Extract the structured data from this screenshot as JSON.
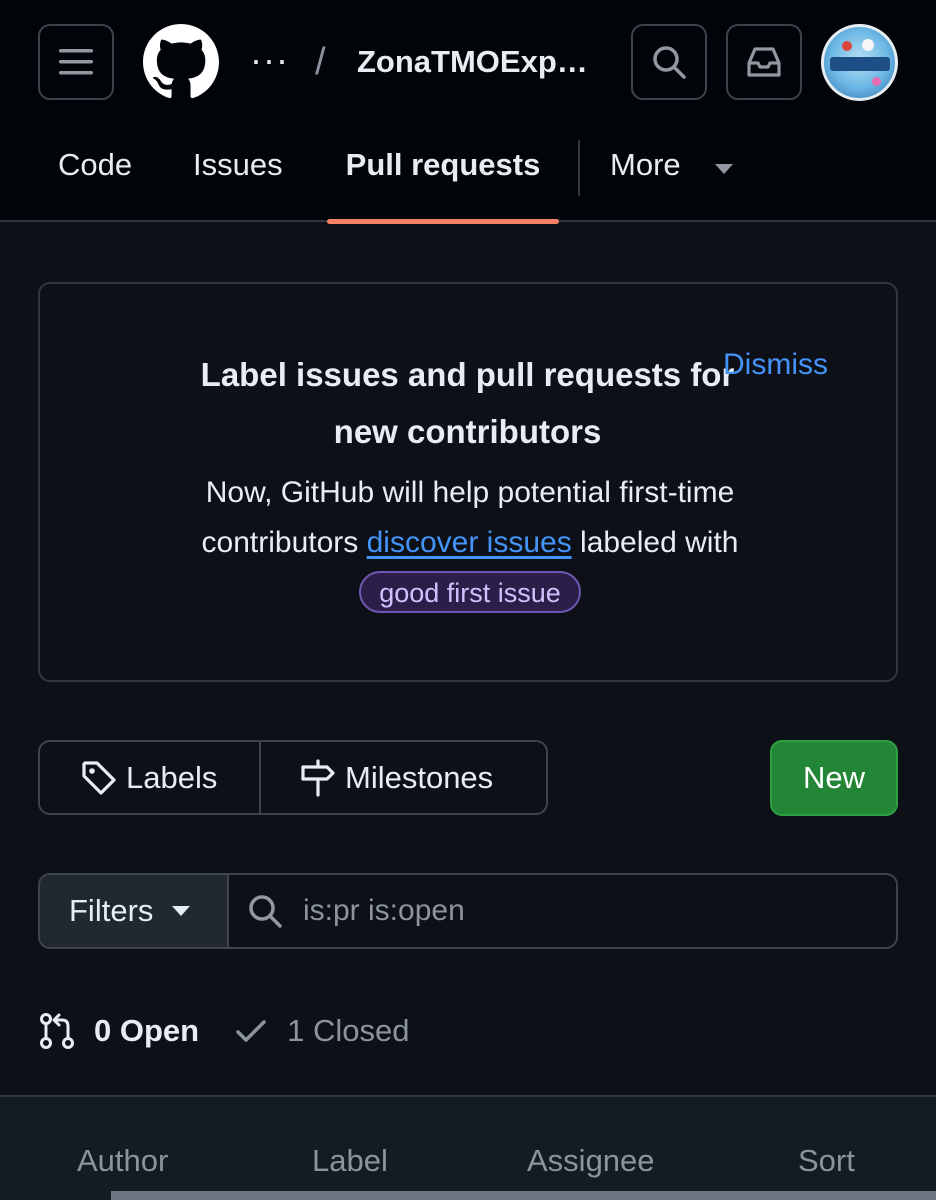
{
  "header": {
    "breadcrumb_ellipsis": "···",
    "separator": "/",
    "repo_name": "ZonaTMOExp…"
  },
  "tabs": [
    {
      "label": "Code"
    },
    {
      "label": "Issues"
    },
    {
      "label": "Pull requests",
      "selected": true
    },
    {
      "label": "More"
    }
  ],
  "banner": {
    "title": "Label issues and pull requests for new contributors",
    "dismiss_label": "Dismiss",
    "body_before_link": "Now, GitHub will help potential first-time contributors ",
    "link_text": "discover issues",
    "body_after_link": " labeled with ",
    "label_chip": "good first issue"
  },
  "actions": {
    "labels": "Labels",
    "milestones": "Milestones",
    "new": "New"
  },
  "filters": {
    "button_label": "Filters",
    "search_placeholder": "is:pr is:open"
  },
  "states": {
    "open": "0 Open",
    "closed": "1 Closed"
  },
  "bottom_filters": [
    "Author",
    "Label",
    "Assignee",
    "Sort"
  ],
  "colors": {
    "accent_underline": "#f78166",
    "link": "#4493f8",
    "new_button": "#238636",
    "background": "#0d1117"
  }
}
